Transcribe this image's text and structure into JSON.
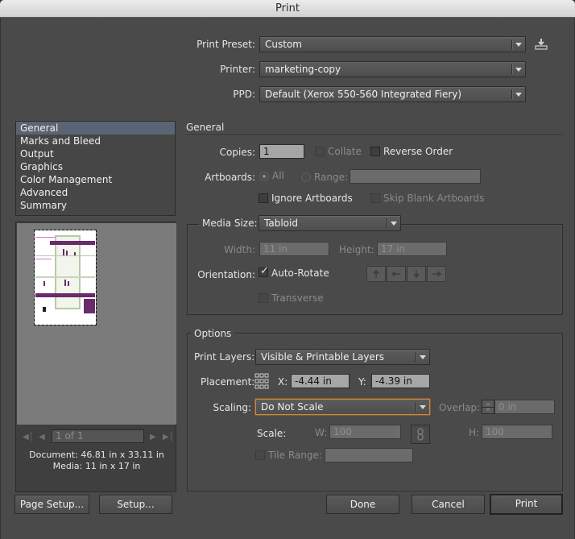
{
  "window": {
    "title": "Print"
  },
  "top": {
    "preset_label": "Print Preset:",
    "preset_value": "Custom",
    "printer_label": "Printer:",
    "printer_value": "marketing-copy",
    "ppd_label": "PPD:",
    "ppd_value": "Default (Xerox 550-560 Integrated Fiery)",
    "save_preset_icon": "save-preset-icon"
  },
  "sidebar": {
    "items": [
      {
        "label": "General",
        "selected": true
      },
      {
        "label": "Marks and Bleed"
      },
      {
        "label": "Output"
      },
      {
        "label": "Graphics"
      },
      {
        "label": "Color Management"
      },
      {
        "label": "Advanced"
      },
      {
        "label": "Summary"
      }
    ]
  },
  "preview": {
    "page_indicator": "1 of 1",
    "document_info": "Document: 46.81 in x 33.11 in",
    "media_info": "Media: 11 in x 17 in"
  },
  "general": {
    "section_title": "General",
    "copies_label": "Copies:",
    "copies_value": "1",
    "collate_label": "Collate",
    "reverse_order_label": "Reverse Order",
    "artboards_label": "Artboards:",
    "all_label": "All",
    "range_label": "Range:",
    "range_value": "",
    "ignore_artboards_label": "Ignore Artboards",
    "skip_blank_label": "Skip Blank Artboards"
  },
  "media": {
    "media_size_label": "Media Size:",
    "media_size_value": "Tabloid",
    "width_label": "Width:",
    "width_value": "11 in",
    "height_label": "Height:",
    "height_value": "17 in",
    "orientation_label": "Orientation:",
    "auto_rotate_label": "Auto-Rotate",
    "auto_rotate_checked": true,
    "transverse_label": "Transverse"
  },
  "options": {
    "section_title": "Options",
    "print_layers_label": "Print Layers:",
    "print_layers_value": "Visible & Printable Layers",
    "placement_label": "Placement:",
    "x_label": "X:",
    "x_value": "-4.44 in",
    "y_label": "Y:",
    "y_value": "-4.39 in",
    "scaling_label": "Scaling:",
    "scaling_value": "Do Not Scale",
    "overlap_label": "Overlap:",
    "overlap_value": "0 in",
    "scale_label": "Scale:",
    "w_label": "W:",
    "w_value": "100",
    "h_label": "H:",
    "h_value": "100",
    "tile_range_label": "Tile Range:",
    "tile_range_value": ""
  },
  "footer": {
    "page_setup": "Page Setup...",
    "setup": "Setup...",
    "done": "Done",
    "cancel": "Cancel",
    "print": "Print"
  },
  "colors": {
    "focus_accent": "#d7872f",
    "list_selection": "#5b6474",
    "preview_purple": "#6b2a6b"
  }
}
